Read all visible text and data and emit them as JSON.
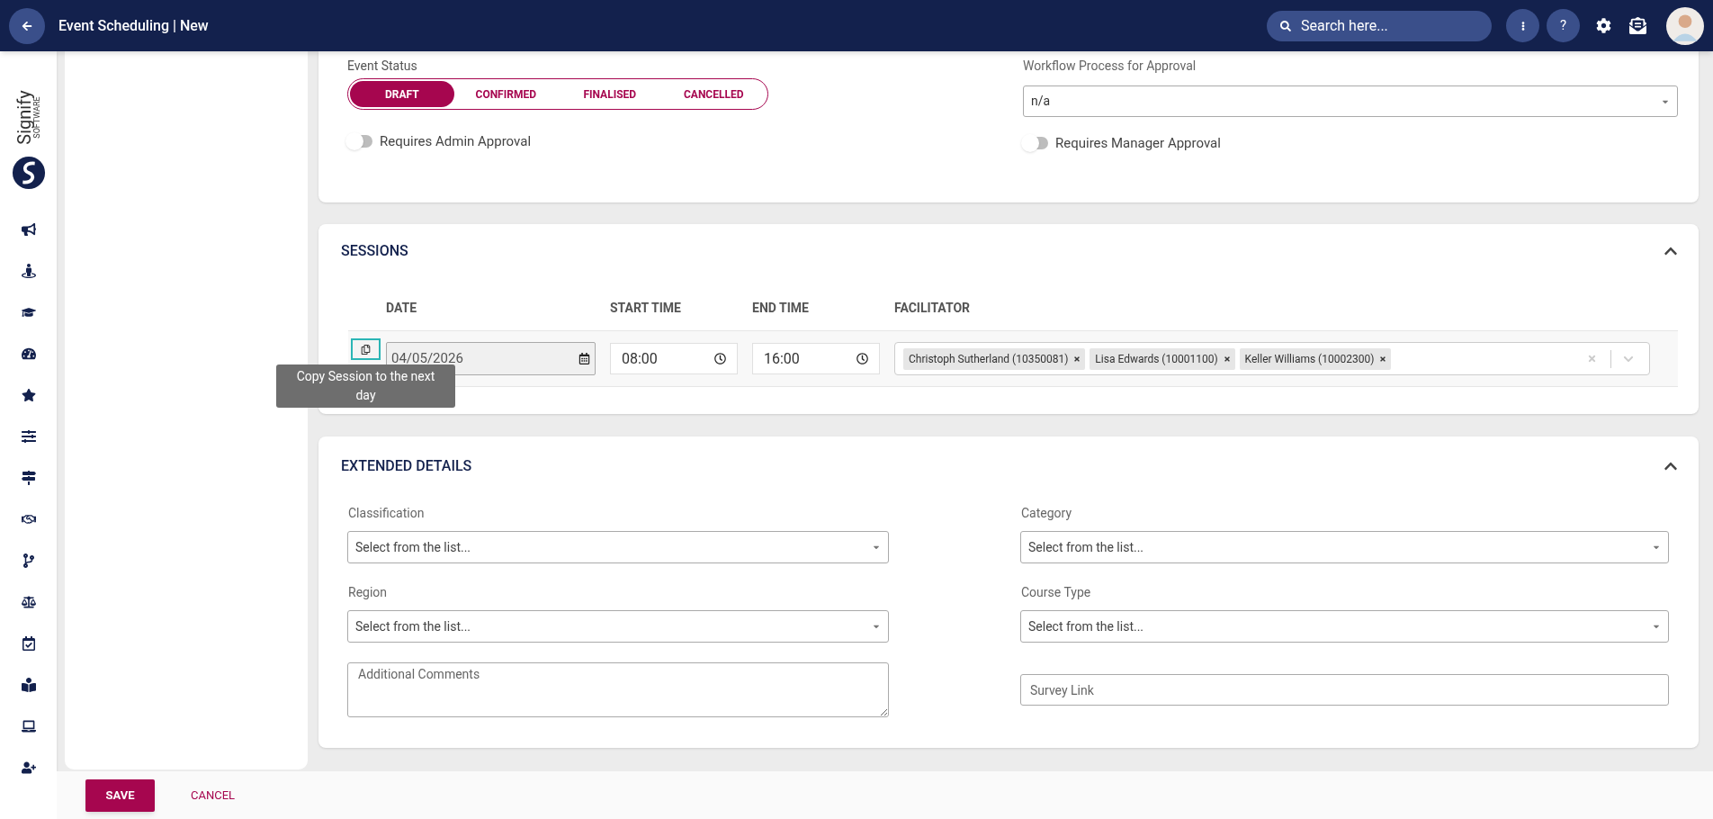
{
  "header": {
    "title": "Event Scheduling | New",
    "search": {
      "placeholder": "Search here..."
    },
    "help_label": "?"
  },
  "logo": {
    "name": "Signify",
    "tagline": "SOFTWARE"
  },
  "event_status": {
    "label": "Event Status",
    "options": [
      {
        "label": "DRAFT",
        "selected": true
      },
      {
        "label": "CONFIRMED",
        "selected": false
      },
      {
        "label": "FINALISED",
        "selected": false
      },
      {
        "label": "CANCELLED",
        "selected": false
      }
    ]
  },
  "workflow": {
    "label": "Workflow Process for Approval",
    "value": "n/a"
  },
  "toggles": [
    {
      "label": "Requires Admin Approval",
      "on": false
    },
    {
      "label": "Requires Manager Approval",
      "on": false
    }
  ],
  "sessions": {
    "title": "SESSIONS",
    "expanded": true,
    "columns": [
      "DATE",
      "START TIME",
      "END TIME",
      "FACILITATOR"
    ],
    "rows": [
      {
        "date": "04/05/2026",
        "start": "08:00",
        "end": "16:00",
        "facilitators": [
          "Christoph Sutherland (10350081)",
          "Lisa Edwards (10001100)",
          "Keller Williams (10002300)"
        ]
      }
    ],
    "tooltip": "Copy Session to the next day"
  },
  "extended": {
    "title": "EXTENDED DETAILS",
    "expanded": true,
    "fields": [
      {
        "kind": "select",
        "label": "Classification",
        "placeholder": "Select from the list..."
      },
      {
        "kind": "select",
        "label": "Category",
        "placeholder": "Select from the list..."
      },
      {
        "kind": "select",
        "label": "Region",
        "placeholder": "Select from the list..."
      },
      {
        "kind": "select",
        "label": "Course Type",
        "placeholder": "Select from the list..."
      },
      {
        "kind": "textarea",
        "placeholder": "Additional Comments"
      },
      {
        "kind": "input",
        "placeholder": "Survey Link"
      }
    ]
  },
  "actions": {
    "save": "SAVE",
    "cancel": "CANCEL"
  }
}
